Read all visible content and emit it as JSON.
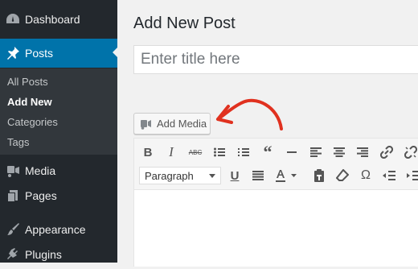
{
  "sidebar": {
    "items": [
      {
        "label": "Dashboard",
        "icon": "dashboard-icon"
      },
      {
        "label": "Posts",
        "icon": "pin-icon",
        "active": true
      },
      {
        "label": "Media",
        "icon": "media-icon"
      },
      {
        "label": "Pages",
        "icon": "pages-icon"
      },
      {
        "label": "Appearance",
        "icon": "brush-icon"
      },
      {
        "label": "Plugins",
        "icon": "plug-icon"
      }
    ],
    "submenu": [
      {
        "label": "All Posts"
      },
      {
        "label": "Add New",
        "current": true
      },
      {
        "label": "Categories"
      },
      {
        "label": "Tags"
      }
    ]
  },
  "main": {
    "title": "Add New Post",
    "title_placeholder": "Enter title here",
    "add_media_label": "Add Media"
  },
  "toolbar": {
    "row1": [
      "bold-icon",
      "italic-icon",
      "strikethrough-icon",
      "bullet-list-icon",
      "numbered-list-icon",
      "blockquote-icon",
      "horizontal-rule-icon",
      "align-left-icon",
      "align-center-icon",
      "align-right-icon",
      "link-icon",
      "unlink-icon"
    ],
    "format_value": "Paragraph",
    "row2": [
      "underline-icon",
      "justify-icon",
      "text-color-icon",
      "paste-text-icon",
      "clear-formatting-icon",
      "special-character-icon",
      "outdent-icon",
      "indent-icon"
    ]
  },
  "colors": {
    "sidebar": "#23282d",
    "active": "#0073aa",
    "arrow": "#e0311f"
  }
}
